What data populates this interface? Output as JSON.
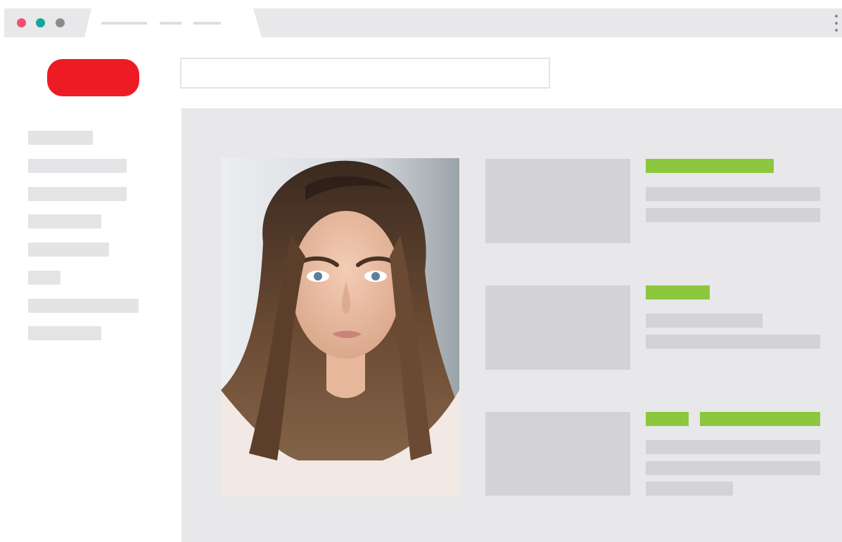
{
  "browser": {
    "window_controls": [
      {
        "name": "close",
        "color": "#f0506e"
      },
      {
        "name": "minimize",
        "color": "#11a79a"
      },
      {
        "name": "maximize",
        "color": "#8c8c8c"
      }
    ],
    "tab_placeholder_lines": 3,
    "menu_icon": "kebab-vertical-icon"
  },
  "header": {
    "logo_color": "#ed1c24",
    "search": {
      "placeholder": ""
    }
  },
  "sidebar": {
    "item_count": 8
  },
  "main": {
    "hero_image": {
      "subject": "portrait-photo",
      "alt": ""
    },
    "cards": [
      {
        "thumbnail": true,
        "tag_color": "#8dc63f",
        "text_lines": 2
      },
      {
        "thumbnail": true,
        "tag_color": "#8dc63f",
        "text_lines": 2
      },
      {
        "thumbnail": true,
        "tag_color": "#8dc63f",
        "tag_count": 2,
        "text_lines": 3
      }
    ]
  },
  "colors": {
    "accent_red": "#ed1c24",
    "accent_green": "#8dc63f",
    "placeholder_gray": "#d3d3d5",
    "panel_gray": "#e8e8ea"
  }
}
